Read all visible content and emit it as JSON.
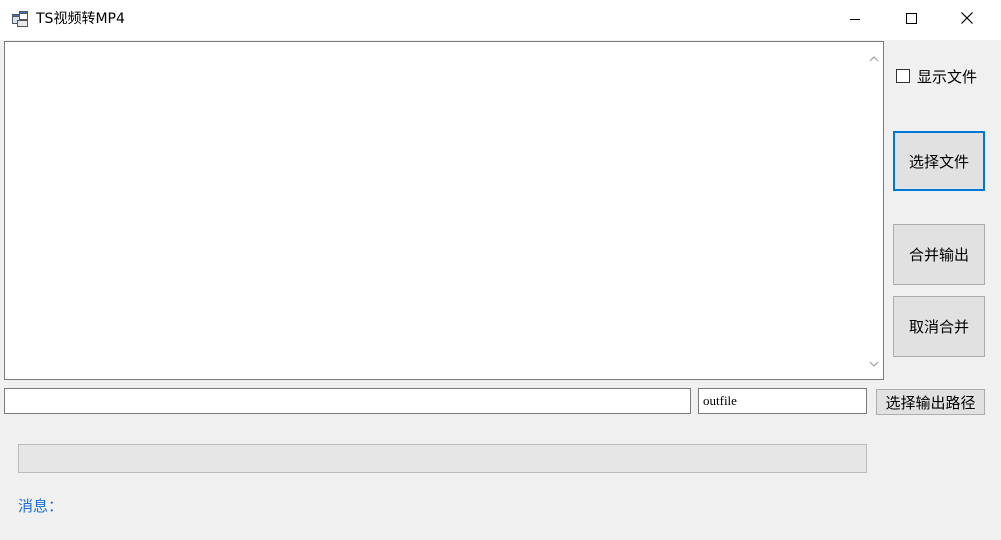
{
  "window": {
    "title": "TS视频转MP4",
    "icon": "app-window-icon"
  },
  "controls": {
    "show_files_label": "显示文件",
    "show_files_checked": false,
    "select_file_label": "选择文件",
    "merge_output_label": "合并输出",
    "cancel_merge_label": "取消合并",
    "output_path_value": "",
    "outfile_name_value": "outfile",
    "select_output_path_label": "选择输出路径",
    "progress_fraction": 0,
    "message_label": "消息："
  },
  "colors": {
    "accent": "#0078d7",
    "message_text": "#1a6fd1"
  }
}
